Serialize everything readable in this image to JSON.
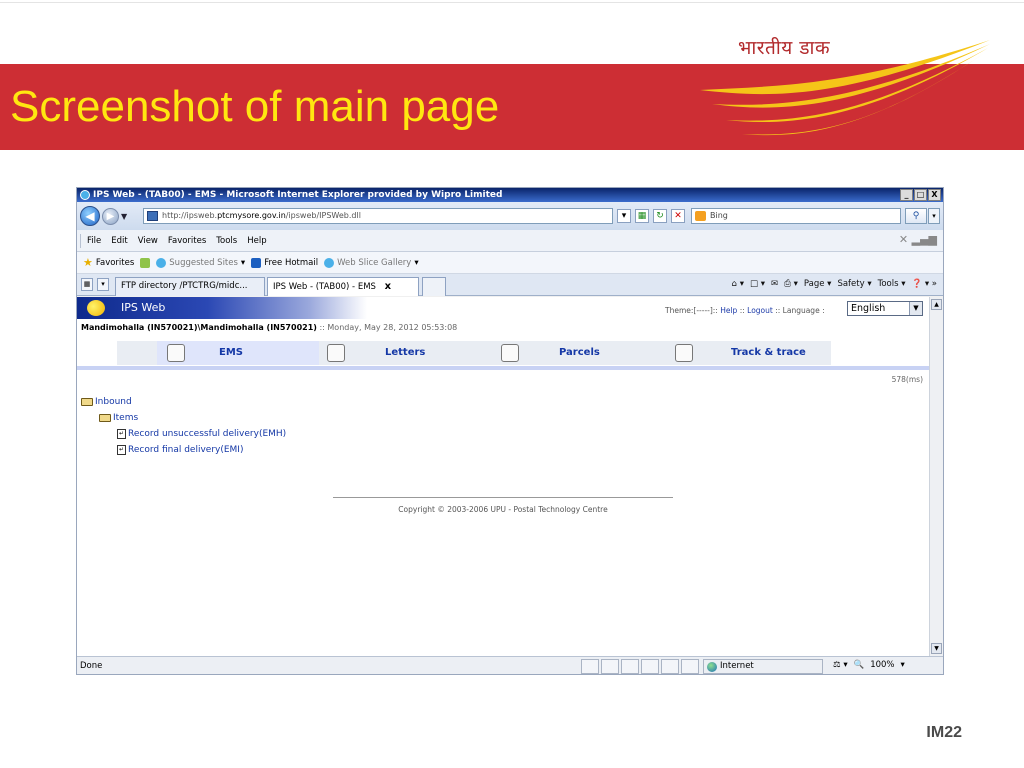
{
  "slide": {
    "title": "Screenshot of main page",
    "brand_text": "भारतीय डाक",
    "footer": "IM22",
    "colors": {
      "banner": "#cd2e34",
      "title": "#ffe710",
      "logo": "#f5c518"
    }
  },
  "browser": {
    "window_title": "IPS Web - (TAB00) - EMS - Microsoft Internet Explorer provided by Wipro Limited",
    "window_buttons": [
      "_",
      "□",
      "X"
    ],
    "address": {
      "url_prefix": "http://ipsweb.",
      "url_host": "ptcmysore.gov.in",
      "url_path": "/ipsweb/IPSWeb.dll",
      "search_value": "Bing"
    },
    "menu": [
      "File",
      "Edit",
      "View",
      "Favorites",
      "Tools",
      "Help"
    ],
    "favorites": {
      "label": "Favorites",
      "suggested_sites": "Suggested Sites",
      "free_hotmail": "Free Hotmail",
      "web_slice_gallery": "Web Slice Gallery"
    },
    "tabs": [
      {
        "label": "FTP directory /PTCTRG/midc..."
      },
      {
        "label": "IPS Web - (TAB00) - EMS",
        "close": "x"
      }
    ],
    "command_bar": [
      "Page ▾",
      "Safety ▾",
      "Tools ▾"
    ],
    "status": {
      "text": "Done",
      "zone": "Internet",
      "zoom": "100%"
    }
  },
  "ips": {
    "app_title": "IPS Web",
    "theme_prefix": "Theme:[-----]:: ",
    "help": "Help",
    "sep1": " :: ",
    "logout": "Logout",
    "sep2": " :: Language :",
    "language_selected": "English",
    "office_path": "Mandimohalla (IN570021)\\Mandimohalla (IN570021)",
    "datetime": " :: Monday, May 28, 2012 05:53:08",
    "module_tabs": [
      "EMS",
      "Letters",
      "Parcels",
      "Track & trace"
    ],
    "timing": "578(ms)",
    "tree": {
      "inbound": "Inbound",
      "items": "Items",
      "record_emh": "Record unsuccessful delivery(EMH)",
      "record_emi": "Record final delivery(EMI)"
    },
    "copyright": "Copyright © 2003-2006 UPU - Postal Technology Centre"
  }
}
